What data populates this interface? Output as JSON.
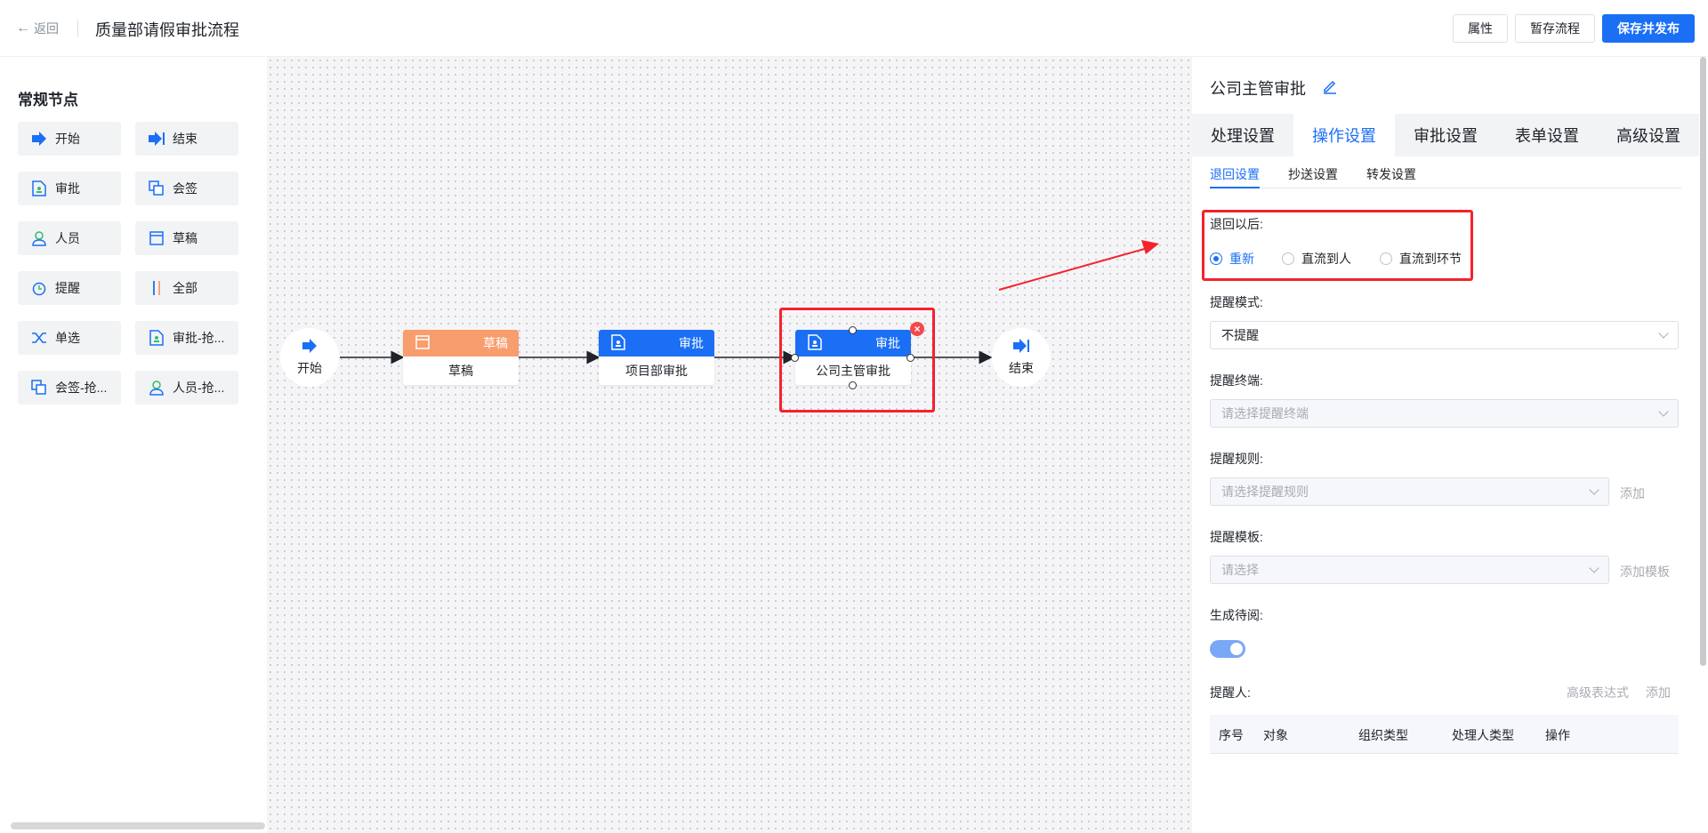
{
  "header": {
    "back_label": "返回",
    "title": "质量部请假审批流程",
    "btn_props": "属性",
    "btn_save_draft": "暂存流程",
    "btn_publish": "保存并发布"
  },
  "palette": {
    "title": "常规节点",
    "items": [
      {
        "label": "开始",
        "icon": "start-flag-icon"
      },
      {
        "label": "结束",
        "icon": "end-flag-icon"
      },
      {
        "label": "审批",
        "icon": "approval-doc-icon"
      },
      {
        "label": "会签",
        "icon": "countersign-icon"
      },
      {
        "label": "人员",
        "icon": "person-icon"
      },
      {
        "label": "草稿",
        "icon": "draft-icon"
      },
      {
        "label": "提醒",
        "icon": "alarm-clock-icon"
      },
      {
        "label": "全部",
        "icon": "all-parallel-icon"
      },
      {
        "label": "单选",
        "icon": "single-choice-icon"
      },
      {
        "label": "审批-抢...",
        "icon": "approval-grab-icon"
      },
      {
        "label": "会签-抢...",
        "icon": "countersign-grab-icon"
      },
      {
        "label": "人员-抢...",
        "icon": "person-grab-icon"
      }
    ]
  },
  "flow": {
    "start_label": "开始",
    "end_label": "结束",
    "nodes": [
      {
        "type": "草稿",
        "name": "草稿",
        "color": "#f89d6e"
      },
      {
        "type": "审批",
        "name": "项目部审批",
        "color": "#1a6ff5"
      },
      {
        "type": "审批",
        "name": "公司主管审批",
        "color": "#1a6ff5"
      }
    ]
  },
  "panel": {
    "title": "公司主管审批",
    "tabs": [
      "处理设置",
      "操作设置",
      "审批设置",
      "表单设置",
      "高级设置"
    ],
    "active_tab": "操作设置",
    "subtabs": [
      "退回设置",
      "抄送设置",
      "转发设置"
    ],
    "active_subtab": "退回设置",
    "return_after_label": "退回以后:",
    "return_options": [
      "重新",
      "直流到人",
      "直流到环节"
    ],
    "return_selected": "重新",
    "remind_mode_label": "提醒模式:",
    "remind_mode_value": "不提醒",
    "remind_terminal_label": "提醒终端:",
    "remind_terminal_placeholder": "请选择提醒终端",
    "remind_rule_label": "提醒规则:",
    "remind_rule_placeholder": "请选择提醒规则",
    "remind_rule_add": "添加",
    "remind_template_label": "提醒模板:",
    "remind_template_placeholder": "请选择",
    "remind_template_add": "添加模板",
    "generate_todo_label": "生成待阅:",
    "generate_todo_on": true,
    "reminder_label": "提醒人:",
    "reminder_adv_expr": "高级表达式",
    "reminder_add": "添加",
    "table_headers": [
      "序号",
      "对象",
      "组织类型",
      "处理人类型",
      "操作"
    ]
  },
  "colors": {
    "accent": "#1a6ff5",
    "draft": "#f89d6e",
    "highlight": "#f5222d"
  }
}
